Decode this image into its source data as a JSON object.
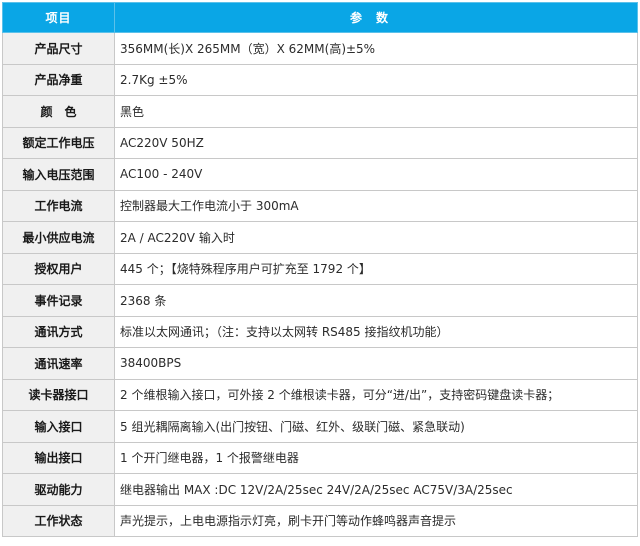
{
  "header": {
    "col_name": "项目",
    "col_value": "参数"
  },
  "rows": [
    {
      "name": "产品尺寸",
      "value": "356MM(长)X 265MM（宽）X 62MM(高)±5%"
    },
    {
      "name": "产品净重",
      "value": "2.7Kg ±5%"
    },
    {
      "name": "颜　色",
      "value": "黑色"
    },
    {
      "name": "额定工作电压",
      "value": "AC220V 50HZ"
    },
    {
      "name": "输入电压范围",
      "value": "AC100 - 240V"
    },
    {
      "name": "工作电流",
      "value": "控制器最大工作电流小于 300mA"
    },
    {
      "name": "最小供应电流",
      "value": "2A / AC220V 输入时"
    },
    {
      "name": "授权用户",
      "value": "445 个；【烧特殊程序用户可扩充至 1792 个】"
    },
    {
      "name": "事件记录",
      "value": "2368 条"
    },
    {
      "name": "通讯方式",
      "value": "标准以太网通讯；（注：支持以太网转 RS485 接指纹机功能）"
    },
    {
      "name": "通讯速率",
      "value": "38400BPS"
    },
    {
      "name": "读卡器接口",
      "value": "2 个维根输入接口，可外接 2 个维根读卡器，可分“进/出”，支持密码键盘读卡器；"
    },
    {
      "name": "输入接口",
      "value": "5 组光耦隔离输入(出门按钮、门磁、红外、级联门磁、紧急联动)"
    },
    {
      "name": "输出接口",
      "value": "1 个开门继电器，1 个报警继电器"
    },
    {
      "name": "驱动能力",
      "value": "继电器输出 MAX :DC 12V/2A/25sec 24V/2A/25sec AC75V/3A/25sec"
    },
    {
      "name": "工作状态",
      "value": "声光提示，上电电源指示灯亮，刷卡开门等动作蜂鸣器声音提示"
    }
  ]
}
